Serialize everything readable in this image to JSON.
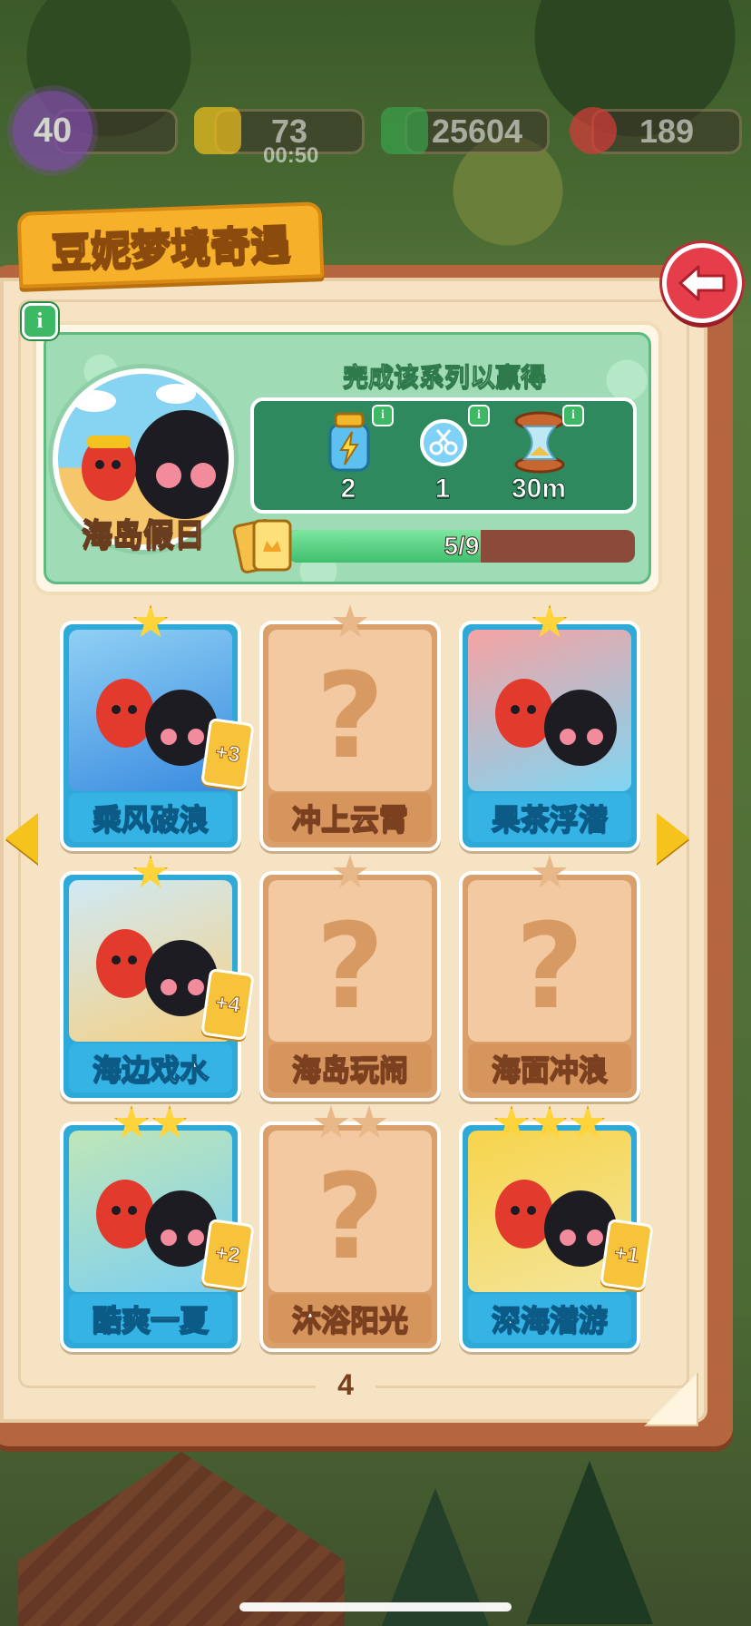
{
  "hud": {
    "level": "40",
    "energy": "73",
    "energy_timer": "00:50",
    "cash": "25604",
    "gems": "189"
  },
  "album": {
    "title": "豆妮梦境奇遇",
    "set_name": "海岛假日",
    "reward_heading": "完成该系列以赢得",
    "rewards": [
      {
        "icon": "energy-bottle-icon",
        "qty": "2"
      },
      {
        "icon": "scissors-bubble-icon",
        "qty": "1"
      },
      {
        "icon": "hourglass-icon",
        "qty": "30m"
      }
    ],
    "progress_text": "5/9",
    "progress_fraction": 0.5556,
    "page_number": "4"
  },
  "cards": [
    {
      "label": "乘风破浪",
      "owned": true,
      "stars": 1,
      "dup": "+3"
    },
    {
      "label": "冲上云霄",
      "owned": false,
      "stars": 1,
      "dup": ""
    },
    {
      "label": "果茶浮潜",
      "owned": true,
      "stars": 1,
      "dup": ""
    },
    {
      "label": "海边戏水",
      "owned": true,
      "stars": 1,
      "dup": "+4"
    },
    {
      "label": "海岛玩闹",
      "owned": false,
      "stars": 1,
      "dup": ""
    },
    {
      "label": "海面冲浪",
      "owned": false,
      "stars": 1,
      "dup": ""
    },
    {
      "label": "酷爽一夏",
      "owned": true,
      "stars": 2,
      "dup": "+2"
    },
    {
      "label": "沐浴阳光",
      "owned": false,
      "stars": 2,
      "dup": ""
    },
    {
      "label": "深海潜游",
      "owned": true,
      "stars": 3,
      "dup": "+1"
    }
  ],
  "colors": {
    "accent_gold": "#f6b02a",
    "back_button": "#e63d4a",
    "owned_card": "#2fa9d8",
    "locked_card": "#d9a06c",
    "progress_fill": "#3fbf6e"
  }
}
